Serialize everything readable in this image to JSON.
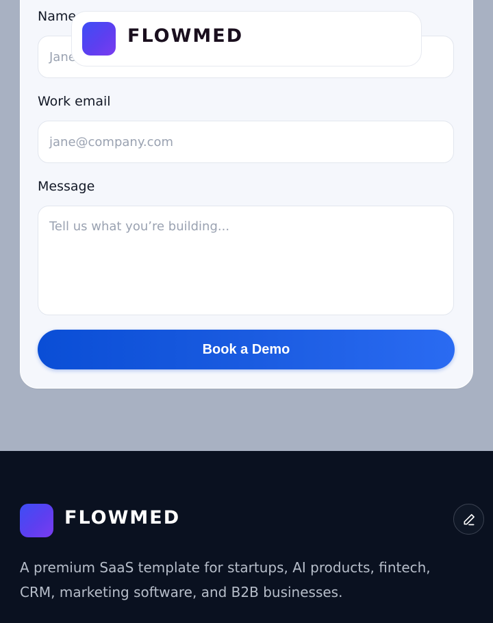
{
  "header": {
    "brand": "FLOWMED"
  },
  "form": {
    "name_label": "Name",
    "name_placeholder": "Jane",
    "email_label": "Work email",
    "email_placeholder": "jane@company.com",
    "message_label": "Message",
    "message_placeholder": "Tell us what you’re building...",
    "submit_label": "Book a Demo"
  },
  "footer": {
    "brand": "FLOWMED",
    "tagline": "A premium SaaS template for startups, AI products, fintech, CRM, marketing software, and B2B businesses.",
    "edit_icon": "pencil-icon"
  },
  "colors": {
    "accent": "#1a5be0",
    "brand_gradient_start": "#3d4ef5",
    "brand_gradient_end": "#7a3cf0",
    "footer_bg": "#0a1120",
    "page_bg": "#a8b1c2"
  }
}
